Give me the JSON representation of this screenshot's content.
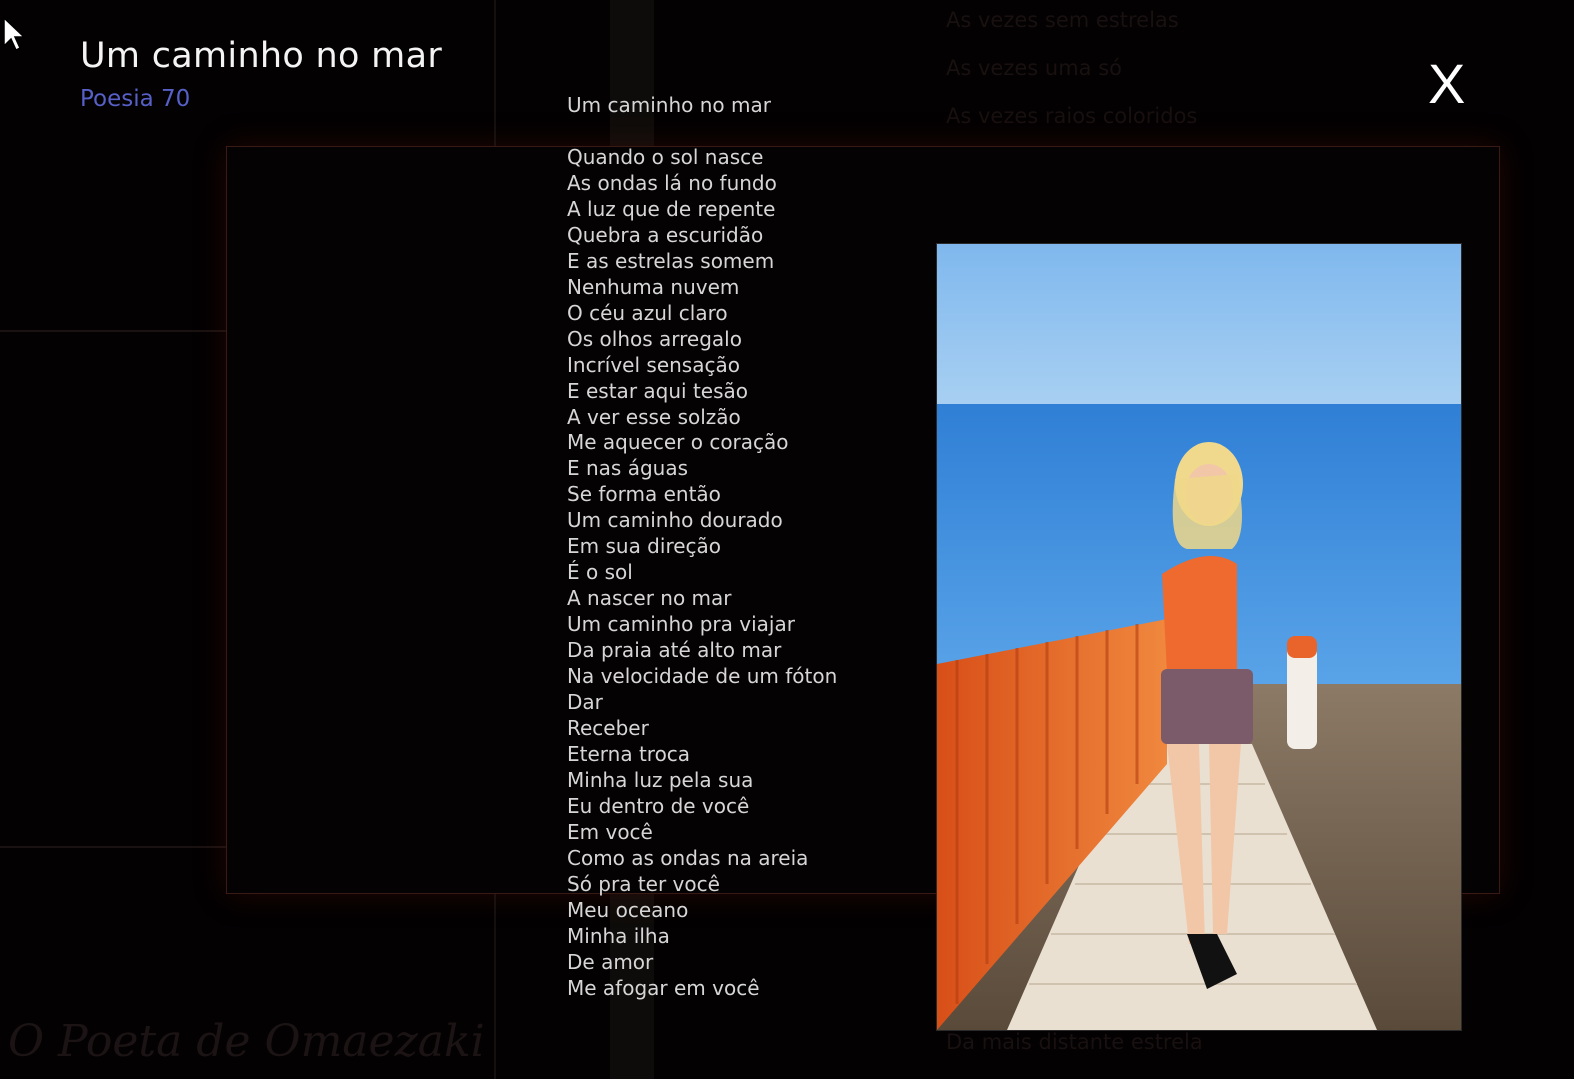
{
  "header": {
    "title": "Um caminho no mar",
    "subtitle": "Poesia 70",
    "close_label": "X"
  },
  "poem": {
    "title": "Um caminho no mar",
    "lines": [
      "Quando o sol nasce",
      "As ondas lá no fundo",
      "A luz que de repente",
      "Quebra a escuridão",
      "E as estrelas somem",
      "Nenhuma nuvem",
      "O céu azul claro",
      "Os olhos arregalo",
      "Incrível sensação",
      "E estar aqui tesão",
      "A ver esse solzão",
      "Me aquecer o coração",
      "E nas águas",
      "Se forma então",
      "Um caminho dourado",
      "Em sua direção",
      "É o sol",
      "A nascer no mar",
      "Um caminho pra viajar",
      "Da praia até alto mar",
      "Na velocidade de um fóton",
      "Dar",
      "Receber",
      "Eterna troca",
      "Minha luz pela sua",
      "Eu dentro de você",
      "Em você",
      "Como as ondas na areia",
      "Só pra ter você",
      "Meu oceano",
      "Minha ilha",
      "De amor",
      "Me afogar em você"
    ]
  },
  "background": {
    "faded_lines": [
      "As vezes sem estrelas",
      "As vezes uma só",
      "As vezes raios coloridos"
    ],
    "faded_bottom": "Da mais distante estrela",
    "watermark": "O Poeta de Omaezaki"
  },
  "colors": {
    "background": "#030102",
    "title": "#f4f4f4",
    "subtitle": "#5660c6",
    "poem_text": "#d6d6d6",
    "frame_border": "#3a1a14",
    "fence": "#e8642a",
    "sea": "#3d8fe0"
  },
  "icons": {
    "cursor": "arrow-cursor-icon"
  }
}
